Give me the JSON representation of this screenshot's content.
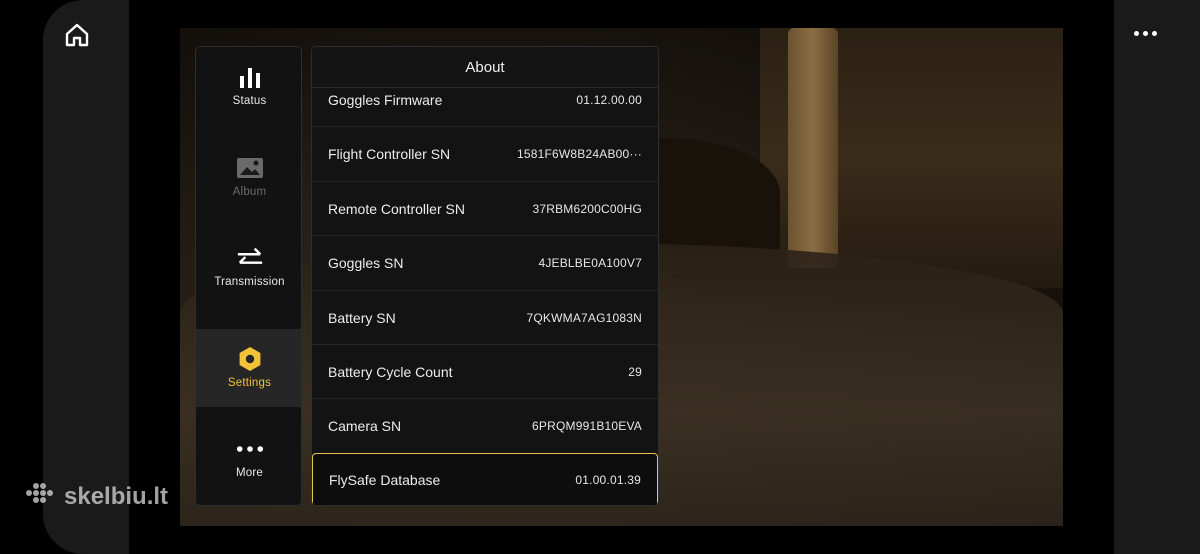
{
  "nav": {
    "items": [
      {
        "label": "Status",
        "icon": "bar-chart-icon",
        "state": "normal"
      },
      {
        "label": "Album",
        "icon": "image-icon",
        "state": "disabled"
      },
      {
        "label": "Transmission",
        "icon": "swap-arrows-icon",
        "state": "normal"
      },
      {
        "label": "Settings",
        "icon": "hex-nut-icon",
        "state": "active"
      },
      {
        "label": "More",
        "icon": "more-dots-icon",
        "state": "normal"
      }
    ]
  },
  "about": {
    "title": "About",
    "rows": [
      {
        "label": "Goggles Firmware",
        "value": "01.12.00.00"
      },
      {
        "label": "Flight Controller SN",
        "value": "1581F6W8B24AB00···"
      },
      {
        "label": "Remote Controller SN",
        "value": "37RBM6200C00HG"
      },
      {
        "label": "Goggles SN",
        "value": "4JEBLBE0A100V7"
      },
      {
        "label": "Battery SN",
        "value": "7QKWMA7AG1083N"
      },
      {
        "label": "Battery Cycle Count",
        "value": "29"
      },
      {
        "label": "Camera SN",
        "value": "6PRQM991B10EVA"
      },
      {
        "label": "FlySafe Database",
        "value": "01.00.01.39"
      }
    ]
  },
  "watermark": {
    "text": "skelbiu.lt"
  },
  "colors": {
    "accent": "#f2c23a",
    "selected_border": "#e8c54a",
    "panel_bg": "#131313"
  }
}
